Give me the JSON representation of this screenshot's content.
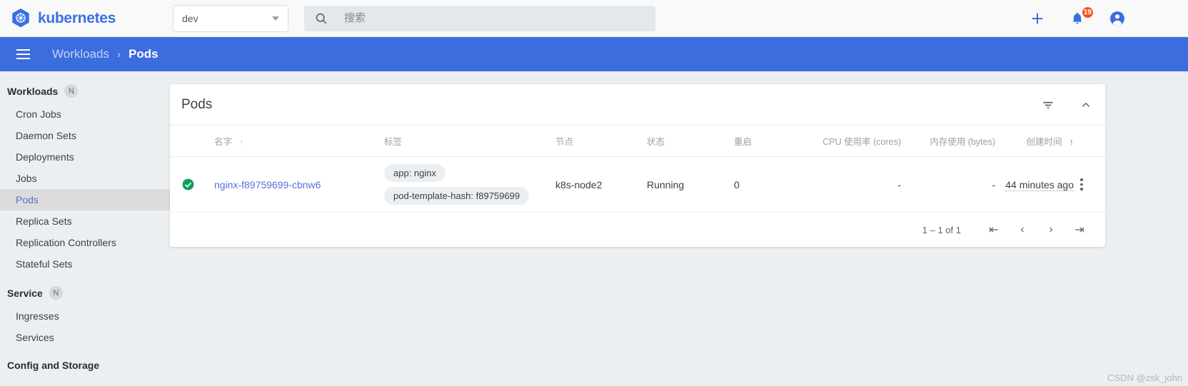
{
  "topbar": {
    "brand": "kubernetes",
    "logo_icon": "kubernetes-helm-logo",
    "namespace": {
      "value": "dev",
      "caret_icon": "chevron-down-icon"
    },
    "search": {
      "placeholder": "搜索",
      "value": "",
      "icon": "search-icon"
    },
    "actions": {
      "create_icon": "plus-icon",
      "notifications_icon": "bell-icon",
      "notifications_count": "19",
      "account_icon": "account-circle-icon"
    }
  },
  "breadcrumb": {
    "menu_icon": "hamburger-menu-icon",
    "parent": "Workloads",
    "separator": "›",
    "current": "Pods"
  },
  "sidebar": {
    "groups": [
      {
        "title": "Workloads",
        "badge": "N",
        "items": [
          {
            "label": "Cron Jobs",
            "selected": false
          },
          {
            "label": "Daemon Sets",
            "selected": false
          },
          {
            "label": "Deployments",
            "selected": false
          },
          {
            "label": "Jobs",
            "selected": false
          },
          {
            "label": "Pods",
            "selected": true
          },
          {
            "label": "Replica Sets",
            "selected": false
          },
          {
            "label": "Replication Controllers",
            "selected": false
          },
          {
            "label": "Stateful Sets",
            "selected": false
          }
        ]
      },
      {
        "title": "Service",
        "badge": "N",
        "items": [
          {
            "label": "Ingresses",
            "selected": false
          },
          {
            "label": "Services",
            "selected": false
          }
        ]
      },
      {
        "title": "Config and Storage",
        "badge": "",
        "items": []
      }
    ]
  },
  "card": {
    "title": "Pods",
    "filter_icon": "filter-list-icon",
    "collapse_icon": "chevron-up-icon",
    "columns": [
      {
        "label": "名字",
        "sort": "inactive"
      },
      {
        "label": "标签",
        "sort": "none"
      },
      {
        "label": "节点",
        "sort": "none"
      },
      {
        "label": "状态",
        "sort": "none"
      },
      {
        "label": "重启",
        "sort": "none"
      },
      {
        "label": "CPU 使用率 (cores)",
        "sort": "none"
      },
      {
        "label": "内存使用 (bytes)",
        "sort": "none"
      },
      {
        "label": "创建时间",
        "sort": "active"
      }
    ],
    "rows": [
      {
        "status_icon": "success-check-icon",
        "name": "nginx-f89759699-cbnw6",
        "labels": [
          "app: nginx",
          "pod-template-hash: f89759699"
        ],
        "node": "k8s-node2",
        "status": "Running",
        "restarts": "0",
        "cpu": "-",
        "memory": "-",
        "created": "44 minutes ago",
        "menu_icon": "more-vert-icon"
      }
    ],
    "pager": {
      "label": "1 – 1 of 1",
      "first_icon": "first-page-icon",
      "prev_icon": "chevron-left-icon",
      "next_icon": "chevron-right-icon",
      "last_icon": "last-page-icon"
    }
  },
  "watermark": "CSDN @zsk_john"
}
